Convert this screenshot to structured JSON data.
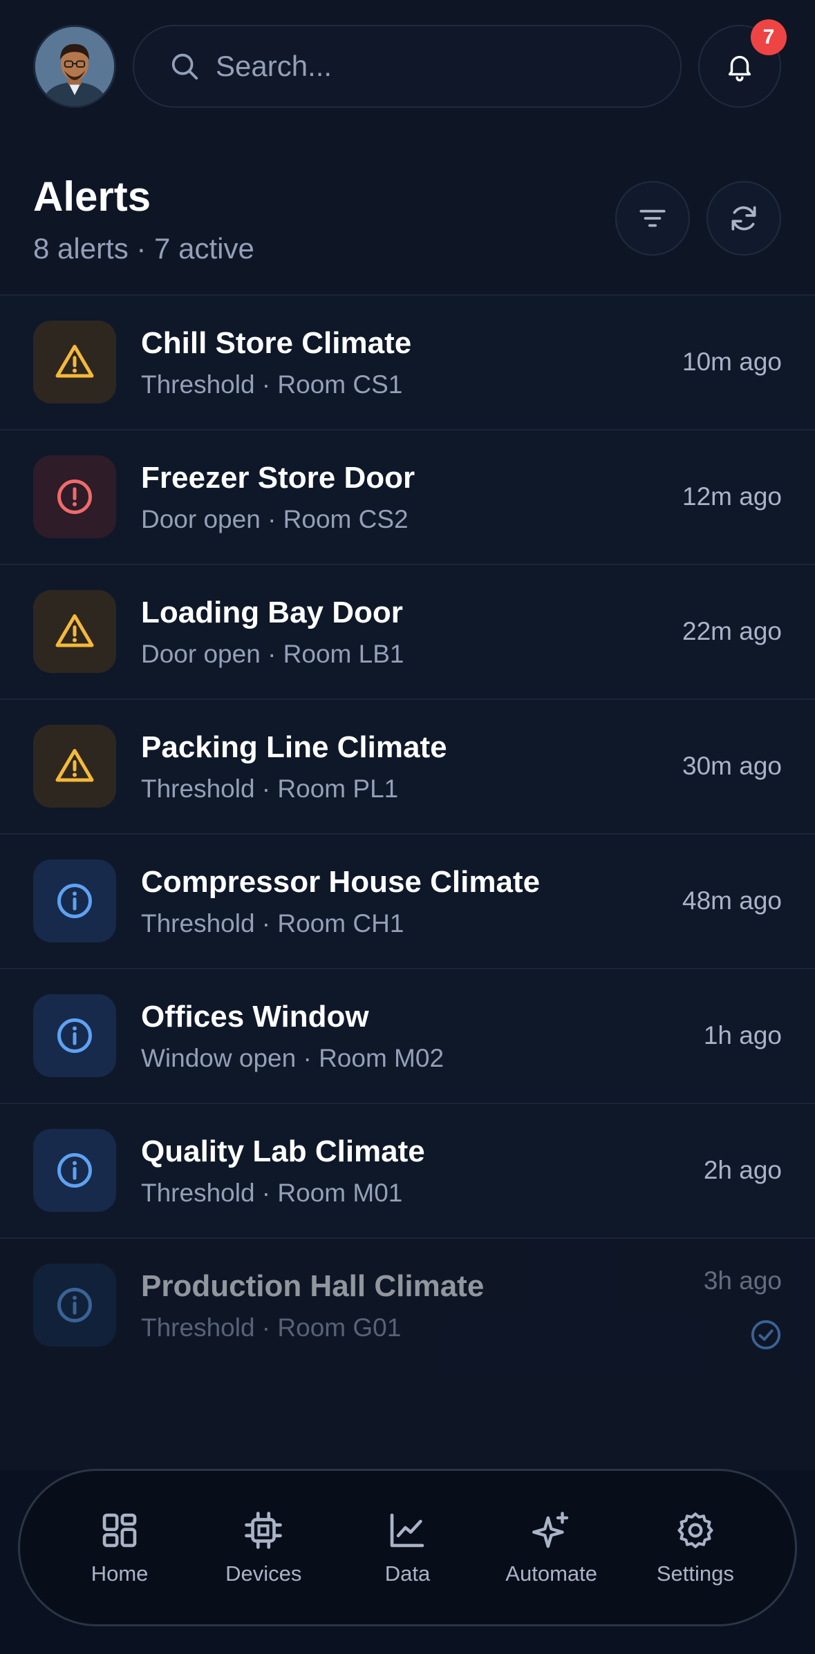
{
  "header": {
    "search_placeholder": "Search...",
    "notification_count": "7"
  },
  "page": {
    "title": "Alerts",
    "subtitle": "8 alerts · 7 active"
  },
  "colors": {
    "warning": "#f5b93a",
    "critical": "#ef6b6b",
    "info": "#5ea2f2",
    "badge": "#ef4444"
  },
  "alerts": [
    {
      "title": "Chill Store Climate",
      "subtitle": "Threshold · Room CS1",
      "time": "10m ago",
      "severity": "warning",
      "icon": "warning-triangle-icon"
    },
    {
      "title": "Freezer Store Door",
      "subtitle": "Door open · Room CS2",
      "time": "12m ago",
      "severity": "critical",
      "icon": "alert-circle-icon"
    },
    {
      "title": "Loading Bay Door",
      "subtitle": "Door open · Room LB1",
      "time": "22m ago",
      "severity": "warning",
      "icon": "warning-triangle-icon"
    },
    {
      "title": "Packing Line Climate",
      "subtitle": "Threshold · Room PL1",
      "time": "30m ago",
      "severity": "warning",
      "icon": "warning-triangle-icon"
    },
    {
      "title": "Compressor House Climate",
      "subtitle": "Threshold · Room CH1",
      "time": "48m ago",
      "severity": "info",
      "icon": "info-circle-icon"
    },
    {
      "title": "Offices Window",
      "subtitle": "Window open · Room M02",
      "time": "1h ago",
      "severity": "info",
      "icon": "info-circle-icon"
    },
    {
      "title": "Quality Lab Climate",
      "subtitle": "Threshold · Room M01",
      "time": "2h ago",
      "severity": "info",
      "icon": "info-circle-icon"
    },
    {
      "title": "Production Hall Climate",
      "subtitle": "Threshold · Room G01",
      "time": "3h ago",
      "severity": "info",
      "icon": "info-circle-icon",
      "resolved": true
    }
  ],
  "nav": [
    {
      "label": "Home",
      "icon": "grid-icon"
    },
    {
      "label": "Devices",
      "icon": "chip-icon"
    },
    {
      "label": "Data",
      "icon": "chart-icon"
    },
    {
      "label": "Automate",
      "icon": "sparkle-icon"
    },
    {
      "label": "Settings",
      "icon": "gear-icon"
    }
  ]
}
